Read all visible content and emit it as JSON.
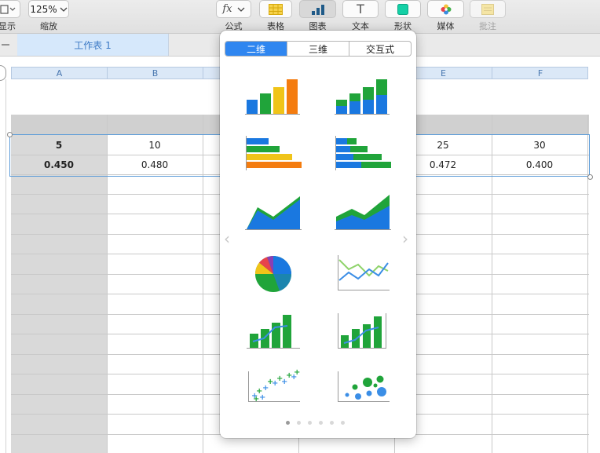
{
  "toolbar": {
    "view_label": "显示",
    "zoom_value": "125%",
    "zoom_label": "缩放",
    "formula_glyph": "fx",
    "formula_label": "公式",
    "table_label": "表格",
    "chart_label": "图表",
    "text_glyph": "T",
    "text_label": "文本",
    "shape_label": "形状",
    "media_label": "媒体",
    "comment_label": "批注"
  },
  "sheet": {
    "tab_label": "工作表 1",
    "columns": [
      "A",
      "B",
      "C",
      "D",
      "E",
      "F"
    ],
    "rows": [
      {
        "A": "5",
        "B": "10",
        "E": "25",
        "F": "30"
      },
      {
        "A": "0.450",
        "B": "0.480",
        "E": "0.472",
        "F": "0.400"
      }
    ]
  },
  "chart_picker": {
    "tabs": [
      "二维",
      "三维",
      "交互式"
    ],
    "active_tab": "二维",
    "chart_types": [
      "column-chart-icon",
      "stacked-column-chart-icon",
      "bar-chart-icon",
      "stacked-bar-chart-icon",
      "area-chart-icon",
      "stacked-area-chart-icon",
      "pie-chart-icon",
      "line-chart-icon",
      "mixed-chart-icon",
      "two-axis-chart-icon",
      "scatter-chart-icon",
      "bubble-chart-icon"
    ],
    "page_count": 6,
    "active_page": 1
  },
  "colors": {
    "blue": "#1a78e0",
    "green": "#20a43a",
    "yellow": "#f0c419",
    "orange": "#f47c0f",
    "selection": "#5b9bd8",
    "accent": "#2f86f0"
  }
}
